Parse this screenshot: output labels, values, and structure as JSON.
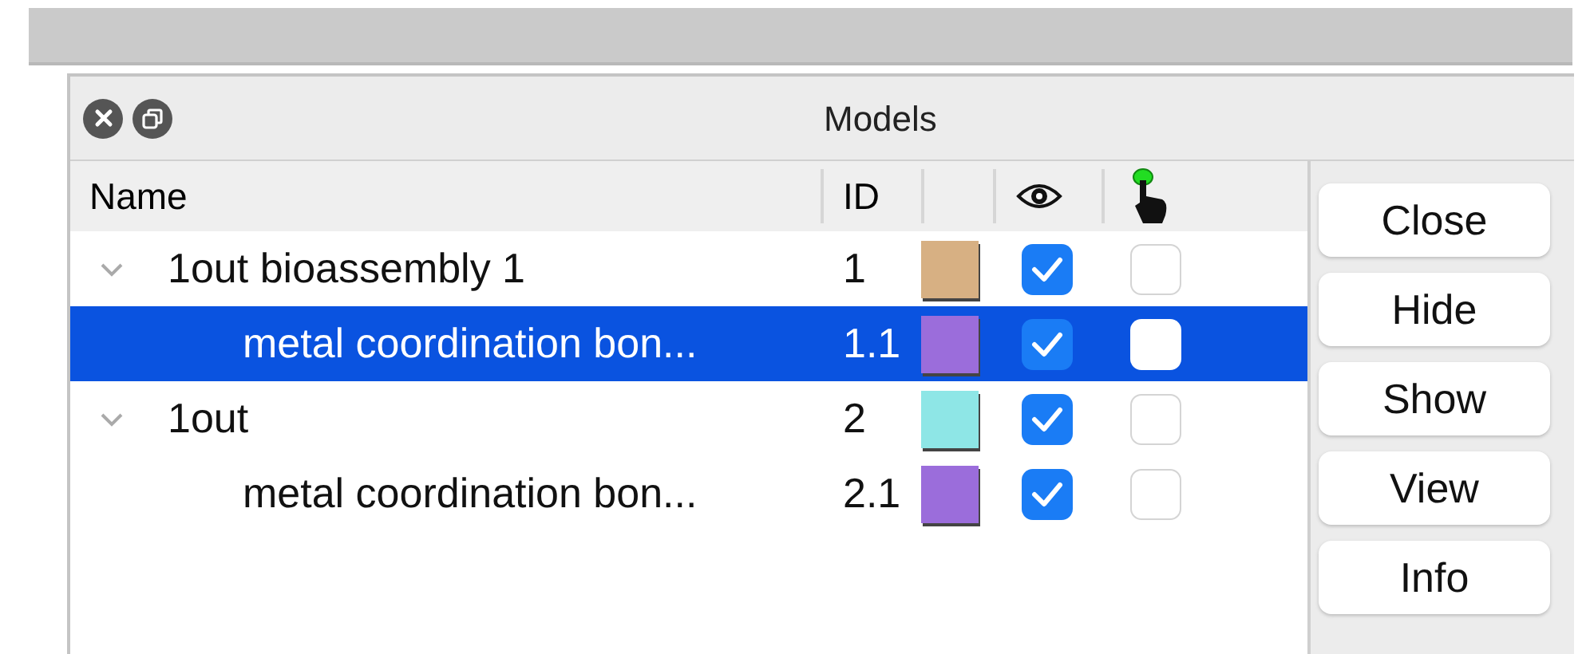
{
  "window": {
    "title": "Models"
  },
  "table": {
    "columns": [
      {
        "kind": "text",
        "label": "Name"
      },
      {
        "kind": "text",
        "label": "ID"
      },
      {
        "kind": "color"
      },
      {
        "kind": "eye"
      },
      {
        "kind": "pointer"
      }
    ],
    "rows": [
      {
        "name": "1out bioassembly 1",
        "id": "1",
        "color": "#d7b083",
        "shown": true,
        "picked": false,
        "selected": false,
        "expanded": true,
        "children": [
          {
            "name": "metal coordination bon...",
            "id": "1.1",
            "color": "#9b6ddb",
            "shown": true,
            "picked": false,
            "selected": true
          }
        ]
      },
      {
        "name": "1out",
        "id": "2",
        "color": "#8ee6e6",
        "shown": true,
        "picked": false,
        "selected": false,
        "expanded": true,
        "children": [
          {
            "name": "metal coordination bon...",
            "id": "2.1",
            "color": "#9b6ddb",
            "shown": true,
            "picked": false,
            "selected": false
          }
        ]
      }
    ]
  },
  "buttons": [
    "Close",
    "Hide",
    "Show",
    "View",
    "Info"
  ]
}
